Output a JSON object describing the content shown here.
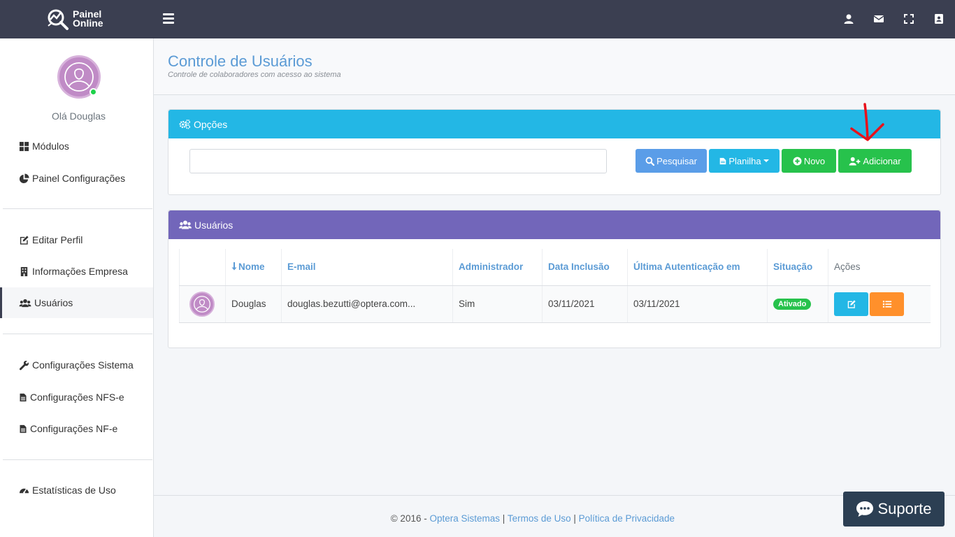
{
  "brand": {
    "line1": "Painel",
    "line2": "Online"
  },
  "topbar": {
    "icons": [
      "user-icon",
      "envelope-icon",
      "expand-icon",
      "address-book-icon"
    ]
  },
  "sidebar": {
    "greeting": "Olá Douglas",
    "items": [
      {
        "label": "Módulos",
        "icon": "grid-icon"
      },
      {
        "label": "Painel Configurações",
        "icon": "pie-chart-icon"
      },
      {
        "label": "Editar Perfil",
        "icon": "edit-icon"
      },
      {
        "label": "Informações Empresa",
        "icon": "building-icon"
      },
      {
        "label": "Usuários",
        "icon": "users-icon",
        "active": true
      },
      {
        "label": "Configurações Sistema",
        "icon": "wrench-icon"
      },
      {
        "label": "Configurações NFS-e",
        "icon": "file-icon"
      },
      {
        "label": "Configurações NF-e",
        "icon": "file-icon"
      },
      {
        "label": "Estatísticas de Uso",
        "icon": "tachometer-icon"
      }
    ]
  },
  "header": {
    "title": "Controle de Usuários",
    "subtitle": "Controle de colaboradores com acesso ao sistema"
  },
  "options_panel": {
    "title": "Opções",
    "search_value": "",
    "buttons": {
      "search": "Pesquisar",
      "spreadsheet": "Planilha",
      "new": "Novo",
      "add": "Adicionar"
    }
  },
  "users_panel": {
    "title": "Usuários",
    "columns": [
      "",
      "Nome",
      "E-mail",
      "Administrador",
      "Data Inclusão",
      "Última Autenticação em",
      "Situação",
      "Ações"
    ],
    "rows": [
      {
        "nome": "Douglas",
        "email": "douglas.bezutti@optera.com...",
        "administrador": "Sim",
        "data_inclusao": "03/11/2021",
        "ultima_autenticacao": "03/11/2021",
        "situacao": "Ativado"
      }
    ]
  },
  "footer": {
    "copyright": "© 2016 -",
    "company": "Optera Sistemas",
    "sep": "|",
    "terms": "Termos de Uso",
    "privacy": "Política de Privacidade"
  },
  "support": {
    "label": "Suporte"
  },
  "colors": {
    "topbar": "#3b3f51",
    "options_header": "#23b7e5",
    "users_header": "#7266ba",
    "success": "#27c24c",
    "warning": "#ff902b",
    "primary": "#5a9de8",
    "title": "#5b9bd5"
  }
}
